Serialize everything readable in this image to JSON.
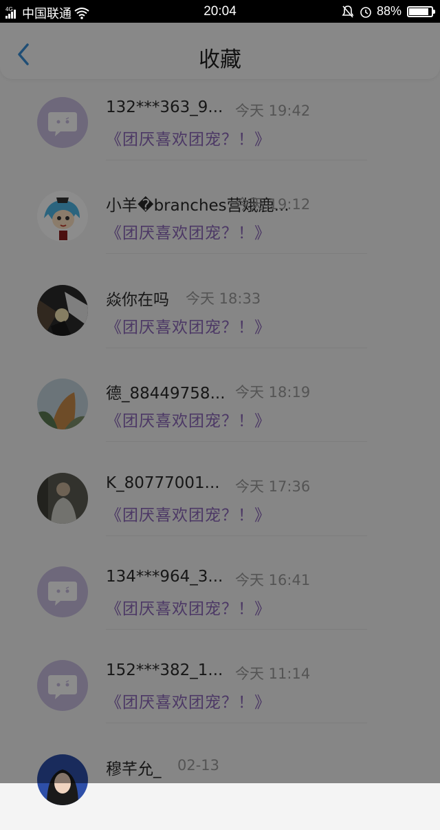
{
  "status_bar": {
    "network": "4G",
    "carrier": "中国联通",
    "time": "20:04",
    "battery": "88%",
    "battery_level": 0.88
  },
  "header": {
    "title": "收藏",
    "back_icon": "chevron-left-icon"
  },
  "favorites": [
    {
      "name": "132***363_9...",
      "time": "今天 19:42",
      "title": "《团厌喜欢团宠？！》",
      "avatar": "default"
    },
    {
      "name": "小羊�branches营娥鹿...",
      "time": "今天 19:12",
      "title": "《团厌喜欢团宠？！》",
      "avatar": "anime"
    },
    {
      "name": "焱你在吗",
      "time": "今天 18:33",
      "title": "《团厌喜欢团宠？！》",
      "avatar": "dark-art"
    },
    {
      "name": "德_88449758...",
      "time": "今天 18:19",
      "title": "《团厌喜欢团宠？！》",
      "avatar": "landscape"
    },
    {
      "name": "K_80777001...",
      "time": "今天 17:36",
      "title": "《团厌喜欢团宠？！》",
      "avatar": "person"
    },
    {
      "name": "134***964_3...",
      "time": "今天 16:41",
      "title": "《团厌喜欢团宠？！》",
      "avatar": "default"
    },
    {
      "name": "152***382_1...",
      "time": "今天 11:14",
      "title": "《团厌喜欢团宠？！》",
      "avatar": "default"
    },
    {
      "name": "穆芊允_",
      "time": "02-13",
      "title": "",
      "avatar": "portrait"
    }
  ],
  "colors": {
    "accent": "#3a8fd6",
    "title_purple": "#8a67b8",
    "default_avatar": "#c9bde0"
  }
}
